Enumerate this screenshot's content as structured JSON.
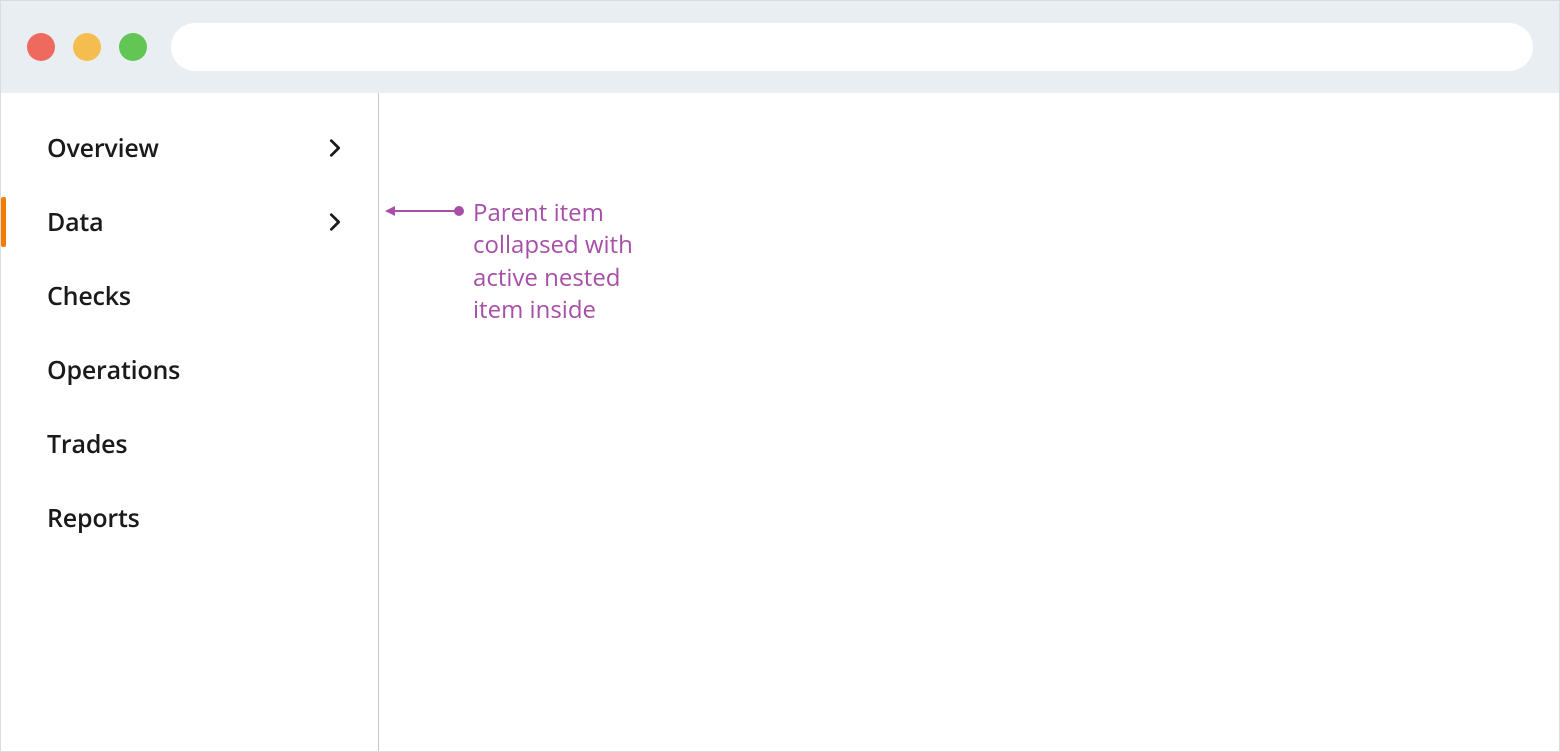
{
  "sidebar": {
    "items": [
      {
        "label": "Overview",
        "expandable": true,
        "active": false
      },
      {
        "label": "Data",
        "expandable": true,
        "active": true
      },
      {
        "label": "Checks",
        "expandable": false,
        "active": false
      },
      {
        "label": "Operations",
        "expandable": false,
        "active": false
      },
      {
        "label": "Trades",
        "expandable": false,
        "active": false
      },
      {
        "label": "Reports",
        "expandable": false,
        "active": false
      }
    ]
  },
  "annotation": {
    "text": "Parent item collapsed with active nested item inside",
    "color": "#a74fa7"
  },
  "colors": {
    "accent": "#f57c00",
    "titlebar": "#e9eef2",
    "annotation": "#a74fa7"
  }
}
